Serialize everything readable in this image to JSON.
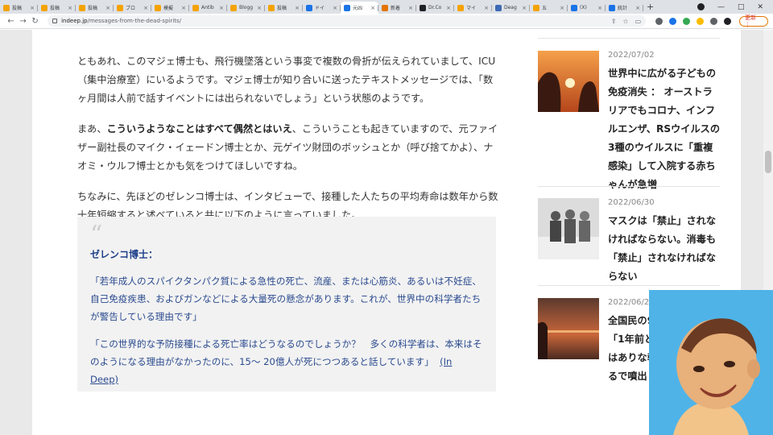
{
  "browser": {
    "tabs": [
      {
        "label": "投稿",
        "color": "#f4a300"
      },
      {
        "label": "投稿",
        "color": "#f4a300"
      },
      {
        "label": "投稿",
        "color": "#f4a300"
      },
      {
        "label": "ブロ",
        "color": "#f4a300"
      },
      {
        "label": "模擬",
        "color": "#f4a300"
      },
      {
        "label": "Antib",
        "color": "#f4a300"
      },
      {
        "label": "Blogg",
        "color": "#f4a300"
      },
      {
        "label": "投稿",
        "color": "#f4a300"
      },
      {
        "label": "ドイ",
        "color": "#1a73e8"
      },
      {
        "label": "元凶",
        "color": "#1a73e8",
        "active": true
      },
      {
        "label": "新着",
        "color": "#e37400"
      },
      {
        "label": "Dr.Co",
        "color": "#202124"
      },
      {
        "label": "マイ",
        "color": "#f4a300"
      },
      {
        "label": "Deag",
        "color": "#3d6ab5"
      },
      {
        "label": "五",
        "color": "#f4a300"
      },
      {
        "label": "(X)",
        "color": "#1a73e8"
      },
      {
        "label": "統計",
        "color": "#1a73e8"
      }
    ],
    "new_tab_label": "+",
    "url_host": "indeep.jp",
    "url_path": "/messages-from-the-dead-spirits/",
    "update_label": "更新 ⋮",
    "accent": "#1a73e8"
  },
  "article": {
    "p1": "ともあれ、このマジェ博士も、飛行機墜落という事変で複数の骨折が伝えられていまして、ICU （集中治療室）にいるようです。マジェ博士が知り合いに送ったテキストメッセージでは、「数ヶ月間は人前で話すイベントには出られないでしょう」という状態のようです。",
    "p2_pre": "まあ、",
    "p2_bold": "こういうようなことはすべて偶然とはいえ",
    "p2_post": "、こういうことも起きていますので、元ファイザー副社長のマイク・イェードン博士とか、元ゲイツ財団のボッシュとか（呼び捨てかよ）、ナオミ・ウルフ博士とかも気をつけてほしいですね。",
    "p3": "ちなみに、先ほどのゼレンコ博士は、インタビューで、接種した人たちの平均寿命は数年から数十年短縮すると述べていると共に以下のように言っていました。"
  },
  "quote": {
    "mark": "“",
    "speaker": "ゼレンコ博士：",
    "q1": "「若年成人のスパイクタンパク質による急性の死亡、流産、または心筋炎、あるいは不妊症、自己免疫疾患、およびガンなどによる大量死の懸念があります。これが、世界中の科学者たちが警告している理由です」",
    "q2": "「この世界的な予防接種による死亡率はどうなるのでしょうか？　多くの科学者は、本来はそのようになる理由がなかったのに、15～ 20億人が死につつあると話しています」",
    "source": "(In Deep)"
  },
  "sidebar": {
    "posts": [
      {
        "date": "2022/07/02",
        "title": "世界中に広がる子どもの免疫消失 ： オーストラリアでもコロナ、インフルエンザ、RSウイルスの3種のウイルスに「重複感染」して入院する赤ちゃんが急増"
      },
      {
        "date": "2022/06/30",
        "title": "マスクは「禁止」されなければならない。消毒も「禁止」されなければならない"
      },
      {
        "date": "2022/06/28",
        "title": "全国民の9割を接種して「1年前と率が23%常ではありな報告。妊に関するで噴出し"
      }
    ]
  }
}
